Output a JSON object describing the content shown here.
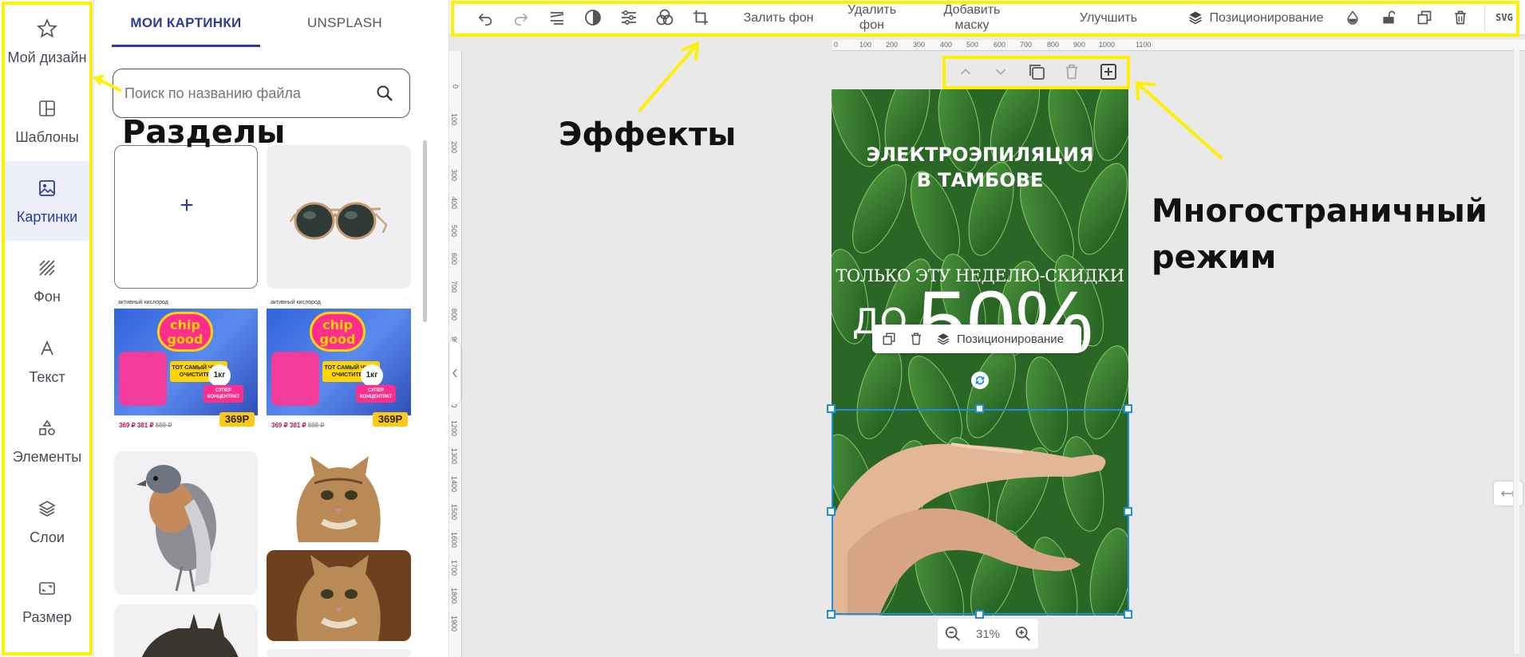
{
  "sidebar": {
    "items": [
      {
        "label": "Мой дизайн",
        "icon": "star-icon"
      },
      {
        "label": "Шаблоны",
        "icon": "template-icon"
      },
      {
        "label": "Картинки",
        "icon": "image-icon"
      },
      {
        "label": "Фон",
        "icon": "background-icon"
      },
      {
        "label": "Текст",
        "icon": "text-icon"
      },
      {
        "label": "Элементы",
        "icon": "shapes-icon"
      },
      {
        "label": "Слои",
        "icon": "layers-icon"
      },
      {
        "label": "Размер",
        "icon": "resize-icon"
      }
    ],
    "active_index": 2
  },
  "panel": {
    "tabs": [
      "МОИ КАРТИНКИ",
      "UNSPLASH"
    ],
    "active_tab": 0,
    "search_placeholder": "Поиск по названию файла",
    "upload_symbol": "+",
    "product_card": {
      "top_caption": "активный кислород",
      "brand_line1": "chip",
      "brand_line2": "good",
      "headline": "ТОТ САМЫЙ ЧУДО-ОЧИСТИТЕЛЬ",
      "weight": "1кг",
      "concentrate": "СУПЕР КОНЦЕНТРАТ",
      "price_badge": "369Р",
      "price_row": "369 ₽   381 ₽   ",
      "old_price": "888 ₽"
    }
  },
  "toolbar": {
    "fill_bg": "Залить фон",
    "remove_bg": "Удалить фон",
    "add_mask": "Добавить маску",
    "enhance": "Улучшить",
    "positioning": "Позиционирование",
    "svg": "SVG"
  },
  "ruler": {
    "h_ticks": [
      "0",
      "100",
      "200",
      "300",
      "400",
      "500",
      "600",
      "700",
      "800",
      "900",
      "1000",
      "1100"
    ],
    "v_ticks": [
      "0",
      "100",
      "200",
      "300",
      "400",
      "500",
      "600",
      "700",
      "800",
      "900",
      "1000",
      "1100",
      "1200",
      "1300",
      "1400",
      "1500",
      "1600",
      "1700",
      "1800",
      "1900"
    ]
  },
  "design": {
    "headline_line1": "ЭЛЕКТРОЭПИЛЯЦИЯ",
    "headline_line2": "В ТАМБОВЕ",
    "subline": "ТОЛЬКО ЭТУ НЕДЕЛЮ-СКИДКИ",
    "discount_prefix": "ДО",
    "discount_value": "50%"
  },
  "context_menu": {
    "positioning": "Позиционирование"
  },
  "zoom": {
    "value": "31%"
  },
  "annotations": {
    "sections": "Разделы",
    "effects": "Эффекты",
    "multipage_line1": "Многостраничный",
    "multipage_line2": "режим"
  },
  "colors": {
    "highlight": "#ffef00",
    "accent": "#2c3a9a",
    "selection": "#1c8fe0"
  }
}
